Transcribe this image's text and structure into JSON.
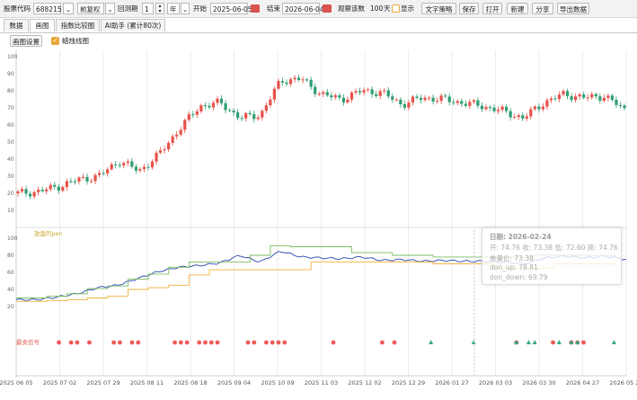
{
  "toolbar": {
    "code_label": "股票代码",
    "code_value": "688215",
    "adjust_value": "前复权",
    "period_label": "回测期",
    "period_value": "1",
    "period_unit": "年",
    "start_label": "开始",
    "start_value": "2025-06-05",
    "end_label": "结束",
    "end_value": "2026-06-04",
    "days_label": "观察该数",
    "days_value": "100",
    "days_unit": "天",
    "show_label": "显示",
    "buttons": [
      "文字策略",
      "保存",
      "打开",
      "新建",
      "分享",
      "导出数据"
    ]
  },
  "tabs": [
    "数据",
    "画图",
    "指数比较图",
    "AI助手 (累计80次)"
  ],
  "options": {
    "settings_label": "画图设置",
    "kline_label": "蜡烛线图"
  },
  "colors": {
    "up": "#e8514a",
    "down": "#2f9e72",
    "price": "#3b57b5",
    "upper": "#7bbd5f",
    "lower": "#efb43c",
    "accent": "#e8a838"
  },
  "chart_data": [
    {
      "type": "candlestick",
      "ylim": [
        0,
        100
      ],
      "yticks": [
        "100",
        "90",
        "80",
        "70",
        "60",
        "50",
        "40",
        "30",
        "20",
        "10"
      ],
      "x": [
        "2025 06 05",
        "2025 07 02",
        "2025 07 29",
        "2025 08 11",
        "2025 08 18",
        "2025 09 04",
        "2025 10 09",
        "2025 11 03",
        "2025 12 02",
        "2025 12 29",
        "2026 01 27",
        "2026 03 03",
        "2026 03 30",
        "2026 04 27",
        "2026 05 27"
      ],
      "close": [
        20,
        21,
        24,
        28,
        30,
        39,
        33,
        43,
        58,
        71,
        73,
        64,
        66,
        86,
        87,
        78,
        75,
        80,
        79,
        72,
        76,
        75,
        73,
        71,
        68,
        64,
        73,
        78,
        76,
        77,
        69
      ]
    },
    {
      "type": "line",
      "ylim": [
        20,
        100
      ],
      "yticks": [
        "100",
        "80",
        "60",
        "40",
        "20"
      ],
      "legend": "放盘的pen",
      "series": [
        {
          "name": "",
          "values": [
            28,
            28,
            31,
            35,
            42,
            45,
            53,
            61,
            66,
            68,
            71,
            80,
            72,
            85,
            78,
            77,
            76,
            78,
            74,
            75,
            73,
            74,
            73,
            73,
            72,
            70,
            77,
            79,
            77,
            79,
            75
          ]
        },
        {
          "name": "don_up",
          "values": [
            30,
            30,
            32,
            35,
            41,
            44,
            52,
            58,
            66,
            72,
            72,
            72,
            80,
            91,
            90,
            90,
            90,
            83,
            83,
            80,
            80,
            78,
            78,
            78,
            78,
            78,
            80,
            80,
            80,
            80,
            80
          ]
        },
        {
          "name": "don_down",
          "values": [
            26,
            26,
            27,
            28,
            30,
            32,
            40,
            42,
            45,
            57,
            63,
            63,
            63,
            63,
            63,
            72,
            72,
            72,
            72,
            72,
            72,
            70,
            70,
            70,
            65,
            65,
            65,
            70,
            70,
            70,
            67
          ]
        }
      ],
      "tooltip": {
        "date": "日期: 2026-02-24",
        "ohlc": "开: 74.76 收: 73.38 低: 72.60 高: 74.76",
        "line1": "参量价: 73.38",
        "line2": "don_up: 78.81",
        "line3": "don_down: 69.79"
      }
    },
    {
      "type": "scatter",
      "label": "最卖信号",
      "buy_positions": [
        0.07,
        0.09,
        0.1,
        0.12,
        0.16,
        0.17,
        0.19,
        0.2,
        0.26,
        0.27,
        0.28,
        0.3,
        0.31,
        0.32,
        0.33,
        0.38,
        0.39,
        0.41,
        0.42,
        0.43,
        0.44,
        0.52,
        0.6,
        0.62,
        0.82,
        0.88,
        0.91,
        0.92,
        0.93
      ],
      "sell_positions": [
        0.68,
        0.75,
        0.82,
        0.84,
        0.85,
        0.89,
        0.91,
        0.92,
        0.98
      ]
    }
  ]
}
